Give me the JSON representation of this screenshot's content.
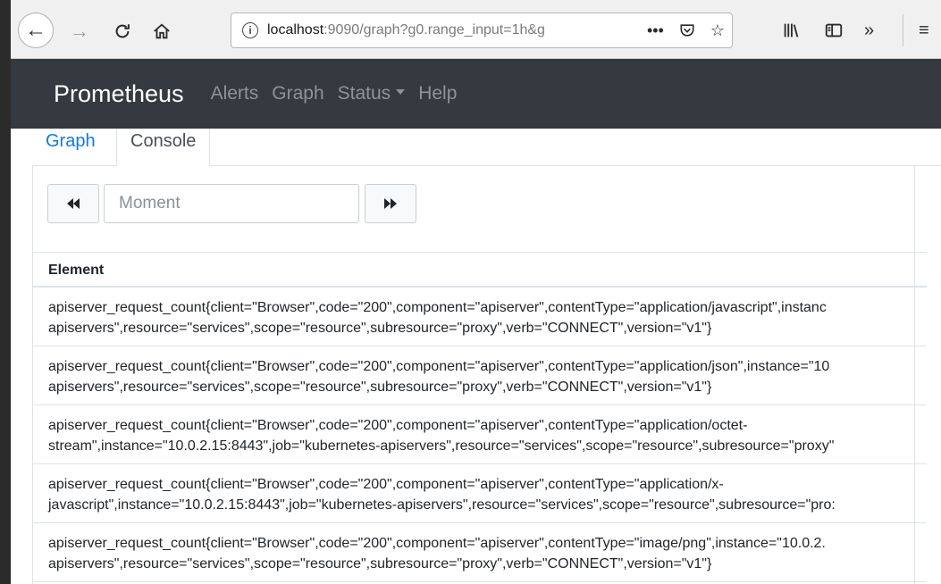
{
  "browser": {
    "url_host": "localhost",
    "url_rest": ":9090/graph?g0.range_input=1h&g",
    "info_glyph": "i",
    "icons": {
      "back": "back-arrow-icon",
      "forward": "forward-arrow-icon",
      "reload": "reload-icon",
      "home": "home-icon",
      "more": "more-icon",
      "pocket": "pocket-icon",
      "bookmark": "star-icon",
      "library": "library-icon",
      "sidebar": "sidebar-icon",
      "overflow": "overflow-icon",
      "menu": "hamburger-menu-icon"
    }
  },
  "navbar": {
    "brand": "Prometheus",
    "links": [
      "Alerts",
      "Graph",
      "Status",
      "Help"
    ],
    "bg_color": "#343a40"
  },
  "tabs": {
    "graph": "Graph",
    "console": "Console",
    "active": "Console",
    "link_color": "#007bff"
  },
  "moment": {
    "placeholder": "Moment"
  },
  "results": {
    "header": "Element",
    "rows": [
      {
        "line1": "apiserver_request_count{client=\"Browser\",code=\"200\",component=\"apiserver\",contentType=\"application/javascript\",instanc",
        "line2": "apiservers\",resource=\"services\",scope=\"resource\",subresource=\"proxy\",verb=\"CONNECT\",version=\"v1\"}"
      },
      {
        "line1": "apiserver_request_count{client=\"Browser\",code=\"200\",component=\"apiserver\",contentType=\"application/json\",instance=\"10",
        "line2": "apiservers\",resource=\"services\",scope=\"resource\",subresource=\"proxy\",verb=\"CONNECT\",version=\"v1\"}"
      },
      {
        "line1": "apiserver_request_count{client=\"Browser\",code=\"200\",component=\"apiserver\",contentType=\"application/octet-",
        "line2": "stream\",instance=\"10.0.2.15:8443\",job=\"kubernetes-apiservers\",resource=\"services\",scope=\"resource\",subresource=\"proxy\""
      },
      {
        "line1": "apiserver_request_count{client=\"Browser\",code=\"200\",component=\"apiserver\",contentType=\"application/x-",
        "line2": "javascript\",instance=\"10.0.2.15:8443\",job=\"kubernetes-apiservers\",resource=\"services\",scope=\"resource\",subresource=\"pro:"
      },
      {
        "line1": "apiserver_request_count{client=\"Browser\",code=\"200\",component=\"apiserver\",contentType=\"image/png\",instance=\"10.0.2.",
        "line2": "apiservers\",resource=\"services\",scope=\"resource\",subresource=\"proxy\",verb=\"CONNECT\",version=\"v1\"}"
      }
    ]
  }
}
